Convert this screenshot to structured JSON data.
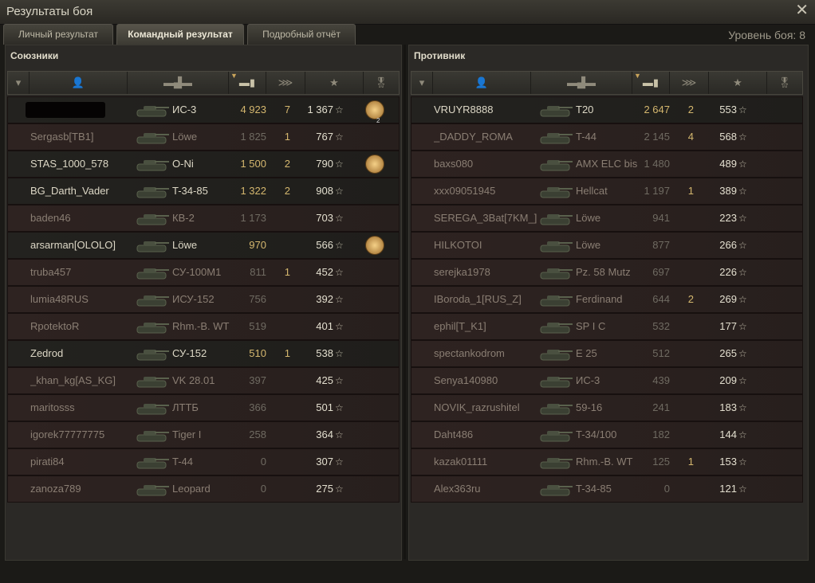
{
  "window": {
    "title": "Результаты боя",
    "close_icon": "close-icon"
  },
  "tabs": [
    {
      "label": "Личный результат",
      "active": false
    },
    {
      "label": "Командный результат",
      "active": true
    },
    {
      "label": "Подробный отчёт",
      "active": false
    }
  ],
  "battle_tier": "Уровень боя: 8",
  "columns": {
    "icons": [
      "squad-icon",
      "player-icon",
      "tank-icon",
      "damage-icon",
      "kills-icon",
      "xp-star-icon",
      "medal-icon"
    ],
    "sorted_column": "damage"
  },
  "allies": {
    "title": "Союзники",
    "rows": [
      {
        "name": "",
        "tank": "ИС-3",
        "damage": "4 923",
        "kills": "7",
        "xp": "1 367",
        "medal": true,
        "medal_count": "2",
        "self": true,
        "alive": true,
        "censored": true
      },
      {
        "name": "Sergasb[TB1]",
        "tank": "Löwe",
        "damage": "1 825",
        "kills": "1",
        "xp": "767",
        "medal": false,
        "alive": false
      },
      {
        "name": "STAS_1000_578",
        "tank": "O-Ni",
        "damage": "1 500",
        "kills": "2",
        "xp": "790",
        "medal": true,
        "alive": true
      },
      {
        "name": "BG_Darth_Vader",
        "tank": "T-34-85",
        "damage": "1 322",
        "kills": "2",
        "xp": "908",
        "medal": false,
        "alive": true
      },
      {
        "name": "baden46",
        "tank": "КВ-2",
        "damage": "1 173",
        "kills": "",
        "xp": "703",
        "medal": false,
        "alive": false
      },
      {
        "name": "arsarman[OLOLO]",
        "tank": "Löwe",
        "damage": "970",
        "kills": "",
        "xp": "566",
        "medal": true,
        "alive": true
      },
      {
        "name": "truba457",
        "tank": "СУ-100М1",
        "damage": "811",
        "kills": "1",
        "xp": "452",
        "medal": false,
        "alive": false
      },
      {
        "name": "lumia48RUS",
        "tank": "ИСУ-152",
        "damage": "756",
        "kills": "",
        "xp": "392",
        "medal": false,
        "alive": false
      },
      {
        "name": "RpotektoR",
        "tank": "Rhm.-B. WT",
        "damage": "519",
        "kills": "",
        "xp": "401",
        "medal": false,
        "alive": false
      },
      {
        "name": "Zedrod",
        "tank": "СУ-152",
        "damage": "510",
        "kills": "1",
        "xp": "538",
        "medal": false,
        "alive": true
      },
      {
        "name": "_khan_kg[AS_KG]",
        "tank": "VK 28.01",
        "damage": "397",
        "kills": "",
        "xp": "425",
        "medal": false,
        "alive": false
      },
      {
        "name": "maritosss",
        "tank": "ЛТТБ",
        "damage": "366",
        "kills": "",
        "xp": "501",
        "medal": false,
        "alive": false
      },
      {
        "name": "igorek77777775",
        "tank": "Tiger I",
        "damage": "258",
        "kills": "",
        "xp": "364",
        "medal": false,
        "alive": false
      },
      {
        "name": "pirati84",
        "tank": "T-44",
        "damage": "0",
        "kills": "",
        "xp": "307",
        "medal": false,
        "alive": false
      },
      {
        "name": "zanoza789",
        "tank": "Leopard",
        "damage": "0",
        "kills": "",
        "xp": "275",
        "medal": false,
        "alive": false
      }
    ]
  },
  "enemies": {
    "title": "Противник",
    "rows": [
      {
        "name": "VRUYR8888",
        "tank": "T20",
        "damage": "2 647",
        "kills": "2",
        "xp": "553",
        "alive": true
      },
      {
        "name": "_DADDY_ROMA",
        "tank": "T-44",
        "damage": "2 145",
        "kills": "4",
        "xp": "568",
        "alive": false
      },
      {
        "name": "baxs080",
        "tank": "AMX ELC bis",
        "damage": "1 480",
        "kills": "",
        "xp": "489",
        "alive": false
      },
      {
        "name": "xxx09051945",
        "tank": "Hellcat",
        "damage": "1 197",
        "kills": "1",
        "xp": "389",
        "alive": false
      },
      {
        "name": "SEREGA_3Bat[7KM_]",
        "tank": "Löwe",
        "damage": "941",
        "kills": "",
        "xp": "223",
        "alive": false
      },
      {
        "name": "HILKOTOI",
        "tank": "Löwe",
        "damage": "877",
        "kills": "",
        "xp": "266",
        "alive": false
      },
      {
        "name": "serejka1978",
        "tank": "Pz. 58 Mutz",
        "damage": "697",
        "kills": "",
        "xp": "226",
        "alive": false
      },
      {
        "name": "IBoroda_1[RUS_Z]",
        "tank": "Ferdinand",
        "damage": "644",
        "kills": "2",
        "xp": "269",
        "alive": false
      },
      {
        "name": "ephil[T_K1]",
        "tank": "SP I C",
        "damage": "532",
        "kills": "",
        "xp": "177",
        "alive": false
      },
      {
        "name": "spectankodrom",
        "tank": "E 25",
        "damage": "512",
        "kills": "",
        "xp": "265",
        "alive": false
      },
      {
        "name": "Senya140980",
        "tank": "ИС-3",
        "damage": "439",
        "kills": "",
        "xp": "209",
        "alive": false
      },
      {
        "name": "NOVIK_razrushitel",
        "tank": "59-16",
        "damage": "241",
        "kills": "",
        "xp": "183",
        "alive": false
      },
      {
        "name": "Daht486",
        "tank": "T-34/100",
        "damage": "182",
        "kills": "",
        "xp": "144",
        "alive": false
      },
      {
        "name": "kazak01111",
        "tank": "Rhm.-B. WT",
        "damage": "125",
        "kills": "1",
        "xp": "153",
        "alive": false
      },
      {
        "name": "Alex363ru",
        "tank": "T-34-85",
        "damage": "0",
        "kills": "",
        "xp": "121",
        "alive": false
      }
    ]
  },
  "colors": {
    "highlight": "#d4b76e",
    "self_row": "#524326"
  }
}
